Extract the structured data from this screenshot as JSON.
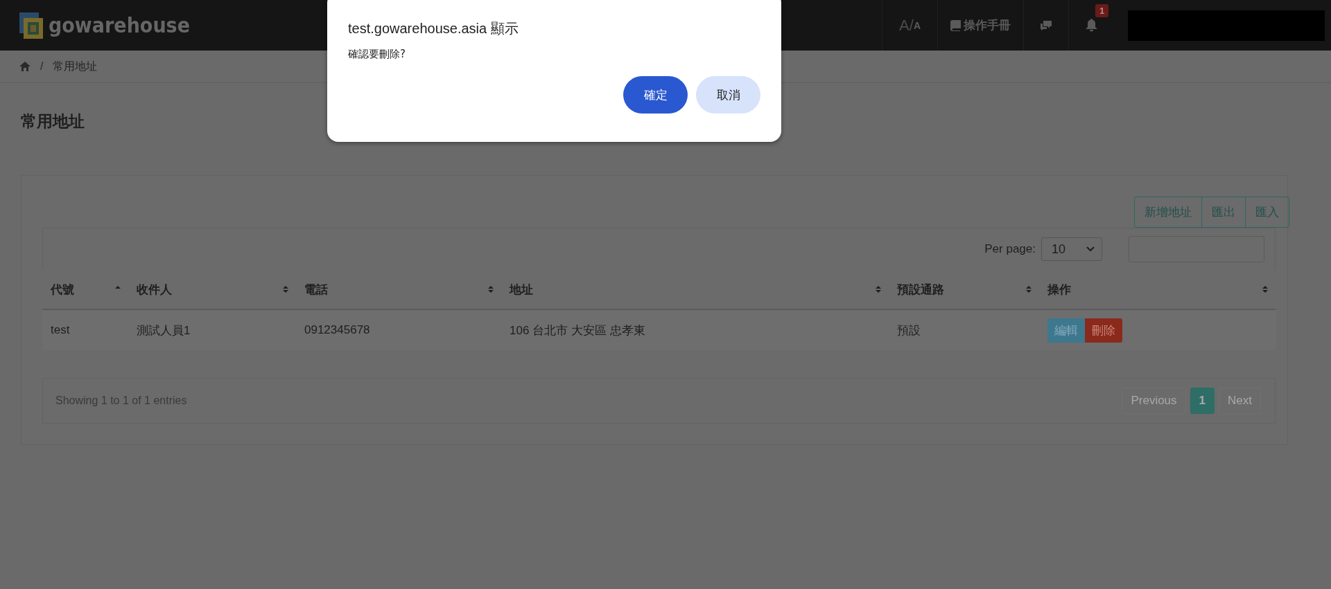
{
  "topbar": {
    "logo": "gowarehouse",
    "font_toggle": {
      "large": "A",
      "separator": "/",
      "small": "A"
    },
    "manual_button": "操作手冊",
    "notification_count": "1"
  },
  "breadcrumb": {
    "separator": "/",
    "items": [
      "常用地址"
    ]
  },
  "page_title": "常用地址",
  "toolbar_buttons": [
    "新增地址",
    "匯出",
    "匯入"
  ],
  "per_page": {
    "label": "Per page:",
    "value": "10"
  },
  "table": {
    "columns": [
      {
        "label": "代號",
        "sorted": true
      },
      {
        "label": "收件人",
        "sorted": false
      },
      {
        "label": "電話",
        "sorted": false
      },
      {
        "label": "地址",
        "sorted": false
      },
      {
        "label": "預設通路",
        "sorted": false
      },
      {
        "label": "操作",
        "sorted": false
      }
    ],
    "rows": [
      {
        "cells": [
          "test",
          "測試人員1",
          "0912345678",
          "106 台北市 大安區 忠孝東",
          "預設"
        ],
        "actions": [
          {
            "label": "編輯",
            "kind": "edit"
          },
          {
            "label": "刪除",
            "kind": "delete"
          }
        ]
      }
    ]
  },
  "info": "Showing 1 to 1 of 1 entries",
  "pagination": [
    {
      "label": "Previous",
      "selected": false,
      "disabled": true
    },
    {
      "label": "1",
      "selected": true,
      "disabled": false
    },
    {
      "label": "Next",
      "selected": false,
      "disabled": true
    }
  ],
  "dialog": {
    "title": "test.gowarehouse.asia 顯示",
    "message": "確認要刪除?",
    "buttons": [
      {
        "label": "確定",
        "kind": "primary"
      },
      {
        "label": "取消",
        "kind": "secondary"
      }
    ]
  }
}
